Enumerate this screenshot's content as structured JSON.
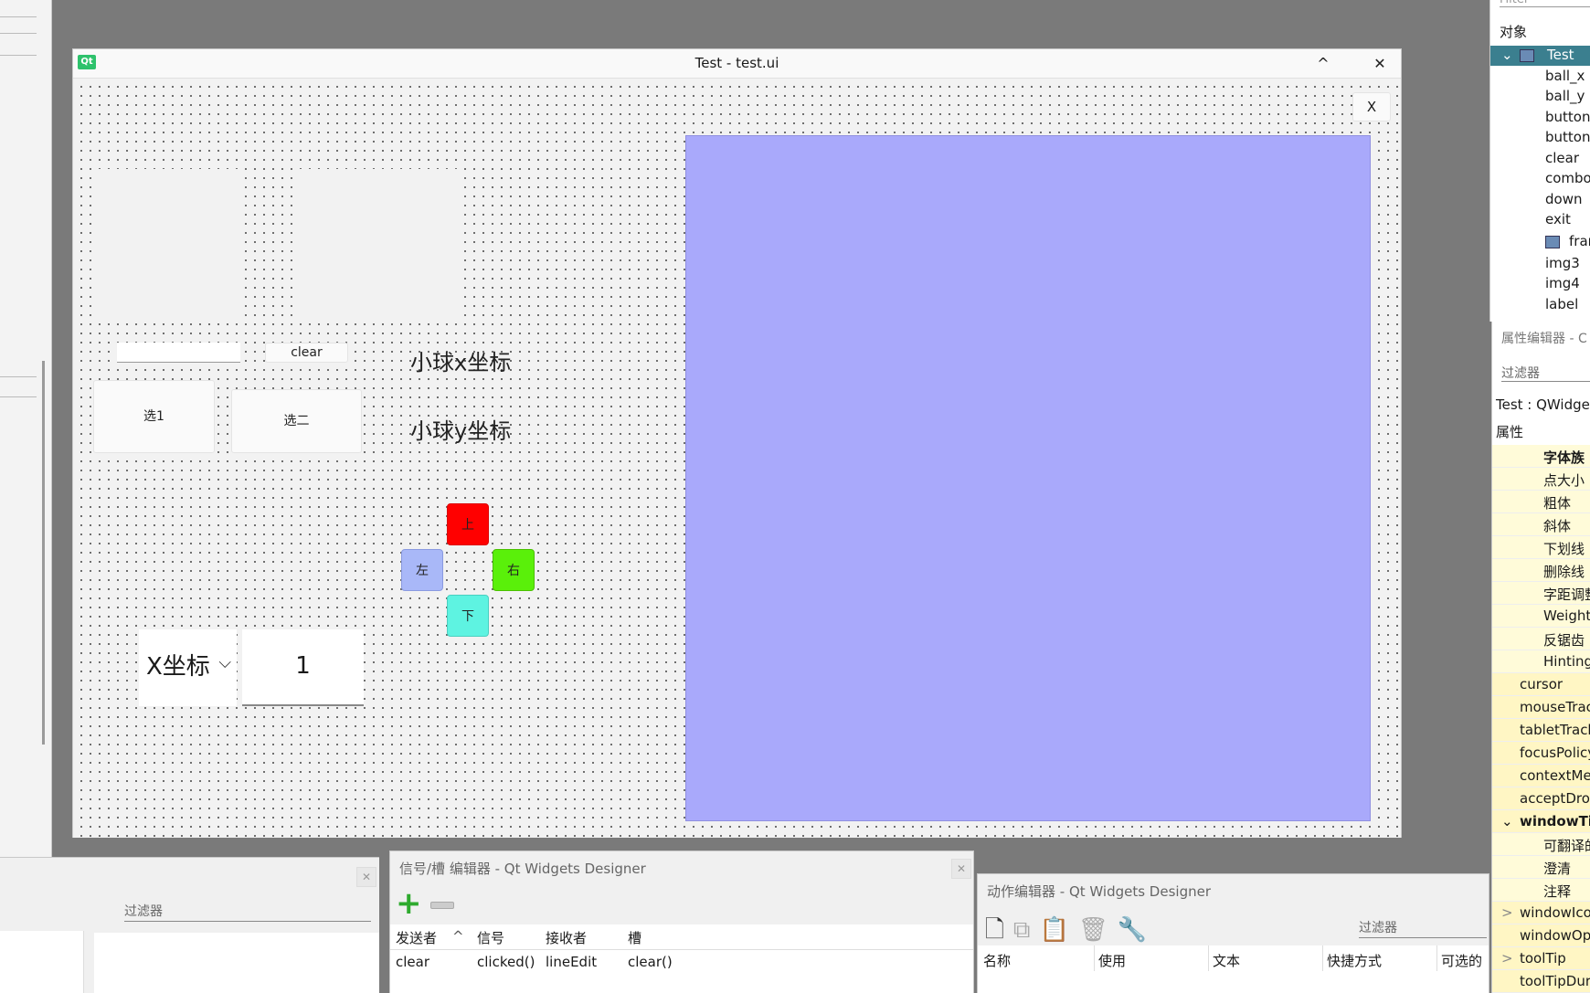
{
  "window": {
    "title": "Test - test.ui",
    "qt_badge": "Qt",
    "maximize_glyph": "^",
    "close_glyph": "✕"
  },
  "form": {
    "clear_button": "clear",
    "option1_button": "选1",
    "option2_button": "选二",
    "ball_x_label": "小球x坐标",
    "ball_y_label": "小球y坐标",
    "up_button": "上",
    "left_button": "左",
    "right_button": "右",
    "down_button": "下",
    "axis_combo_value": "X坐标",
    "spin_value": "1",
    "exit_button": "X",
    "colors": {
      "canvas": "#a9a9fb",
      "up": "#ff0000",
      "left": "#a9b8f8",
      "right": "#5af00a",
      "down": "#5ef3e1"
    }
  },
  "left_dock": {
    "close_glyph": "✕",
    "filter_placeholder": "过滤器"
  },
  "signal_slot_editor": {
    "title": "信号/槽 编辑器 - Qt Widgets Designer",
    "close_glyph": "✕",
    "add_icon": "plus-icon",
    "remove_icon": "minus-icon",
    "columns": [
      "发送者",
      "信号",
      "接收者",
      "槽"
    ],
    "sort_indicator": "^",
    "rows": [
      {
        "sender": "clear",
        "signal": "clicked()",
        "receiver": "lineEdit",
        "slot": "clear()"
      }
    ]
  },
  "action_editor": {
    "title": "动作编辑器 - Qt Widgets Designer",
    "filter_placeholder": "过滤器",
    "columns": [
      "名称",
      "使用",
      "文本",
      "快捷方式",
      "可选的"
    ]
  },
  "object_inspector": {
    "filter_placeholder": "Filter",
    "header": "对象",
    "expand_glyph": "⌄",
    "items": [
      "Test",
      "ball_x",
      "ball_y",
      "button",
      "button",
      "clear",
      "combo",
      "down",
      "exit",
      "fran",
      "img3",
      "img4",
      "label"
    ]
  },
  "property_editor": {
    "title": "属性编辑器 - C",
    "filter_placeholder": "过滤器",
    "class_label": "Test : QWidget",
    "header": "属性",
    "expand_glyph": "⌄",
    "collapse_glyph": ">",
    "font_subprops": [
      "字体族",
      "点大小",
      "粗体",
      "斜体",
      "下划线",
      "删除线",
      "字距调整",
      "Weight",
      "反锯齿",
      "Hinting"
    ],
    "props": [
      "cursor",
      "mouseTrac",
      "tabletTrack",
      "focusPolicy",
      "contextMe",
      "acceptDrop"
    ],
    "window_title_prop": "windowTit",
    "window_title_subprops": [
      "可翻译的",
      "澄清",
      "注释"
    ],
    "tail_props": [
      "windowIco",
      "windowOp",
      "toolTip",
      "toolTipDur"
    ]
  }
}
